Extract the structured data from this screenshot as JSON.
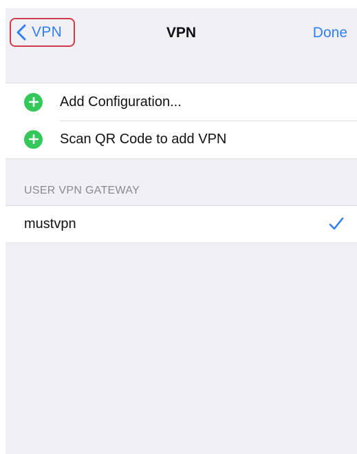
{
  "navbar": {
    "back_label": "VPN",
    "title": "VPN",
    "done_label": "Done"
  },
  "actions": {
    "items": [
      {
        "label": "Add Configuration...",
        "icon": "plus-circle-icon"
      },
      {
        "label": "Scan QR Code to add VPN",
        "icon": "plus-circle-icon"
      }
    ]
  },
  "gateway_section": {
    "header": "USER VPN GATEWAY",
    "items": [
      {
        "name": "mustvpn",
        "selected": true,
        "icon": "checkmark-icon"
      }
    ]
  },
  "colors": {
    "accent": "#2f7ff6",
    "add_green": "#34c759",
    "highlight_red": "#d23a47",
    "background": "#f1f1f5"
  }
}
